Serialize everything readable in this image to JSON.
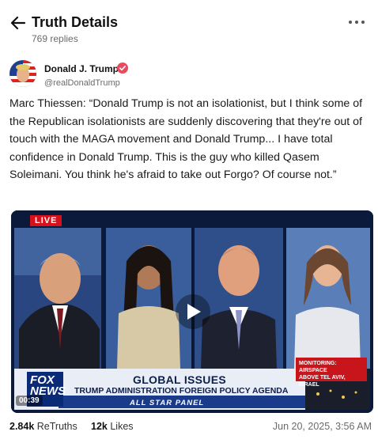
{
  "header": {
    "title": "Truth Details",
    "subtitle": "769 replies"
  },
  "author": {
    "name": "Donald J. Trump",
    "handle": "@realDonaldTrump"
  },
  "post": {
    "text": "Marc Thiessen: “Donald Trump is not an isolationist, but I think some of the Republican isolationists are suddenly discovering that they're out of touch with the MAGA movement and Donald Trump... I have total confidence in Donald Trump. This is the guy who killed Qasem Soleimani. You think he's afraid to take out Forgo? Of course not.”"
  },
  "video": {
    "live_label": "LIVE",
    "lower_third_title": "GLOBAL ISSUES",
    "lower_third_subtitle": "TRUMP ADMINISTRATION FOREIGN POLICY AGENDA",
    "lower_third_panel": "ALL STAR PANEL",
    "network_logo": "FOX NEWS",
    "monitor_line1": "MONITORING: AIRSPACE",
    "monitor_line2": "ABOVE TEL AVIV, ISRAEL",
    "timestamp": "00:39"
  },
  "stats": {
    "retruths_count": "2.84k",
    "retruths_label": "ReTruths",
    "likes_count": "12k",
    "likes_label": "Likes",
    "date": "Jun 20, 2025, 3:56 AM"
  },
  "icons": {
    "back": "arrow-left-icon",
    "more": "more-horizontal-icon",
    "verified": "verified-badge-icon",
    "play": "play-icon"
  },
  "colors": {
    "verified_badge": "#e84a5f",
    "live_red": "#d7111b",
    "fox_blue": "#0a2a78"
  }
}
